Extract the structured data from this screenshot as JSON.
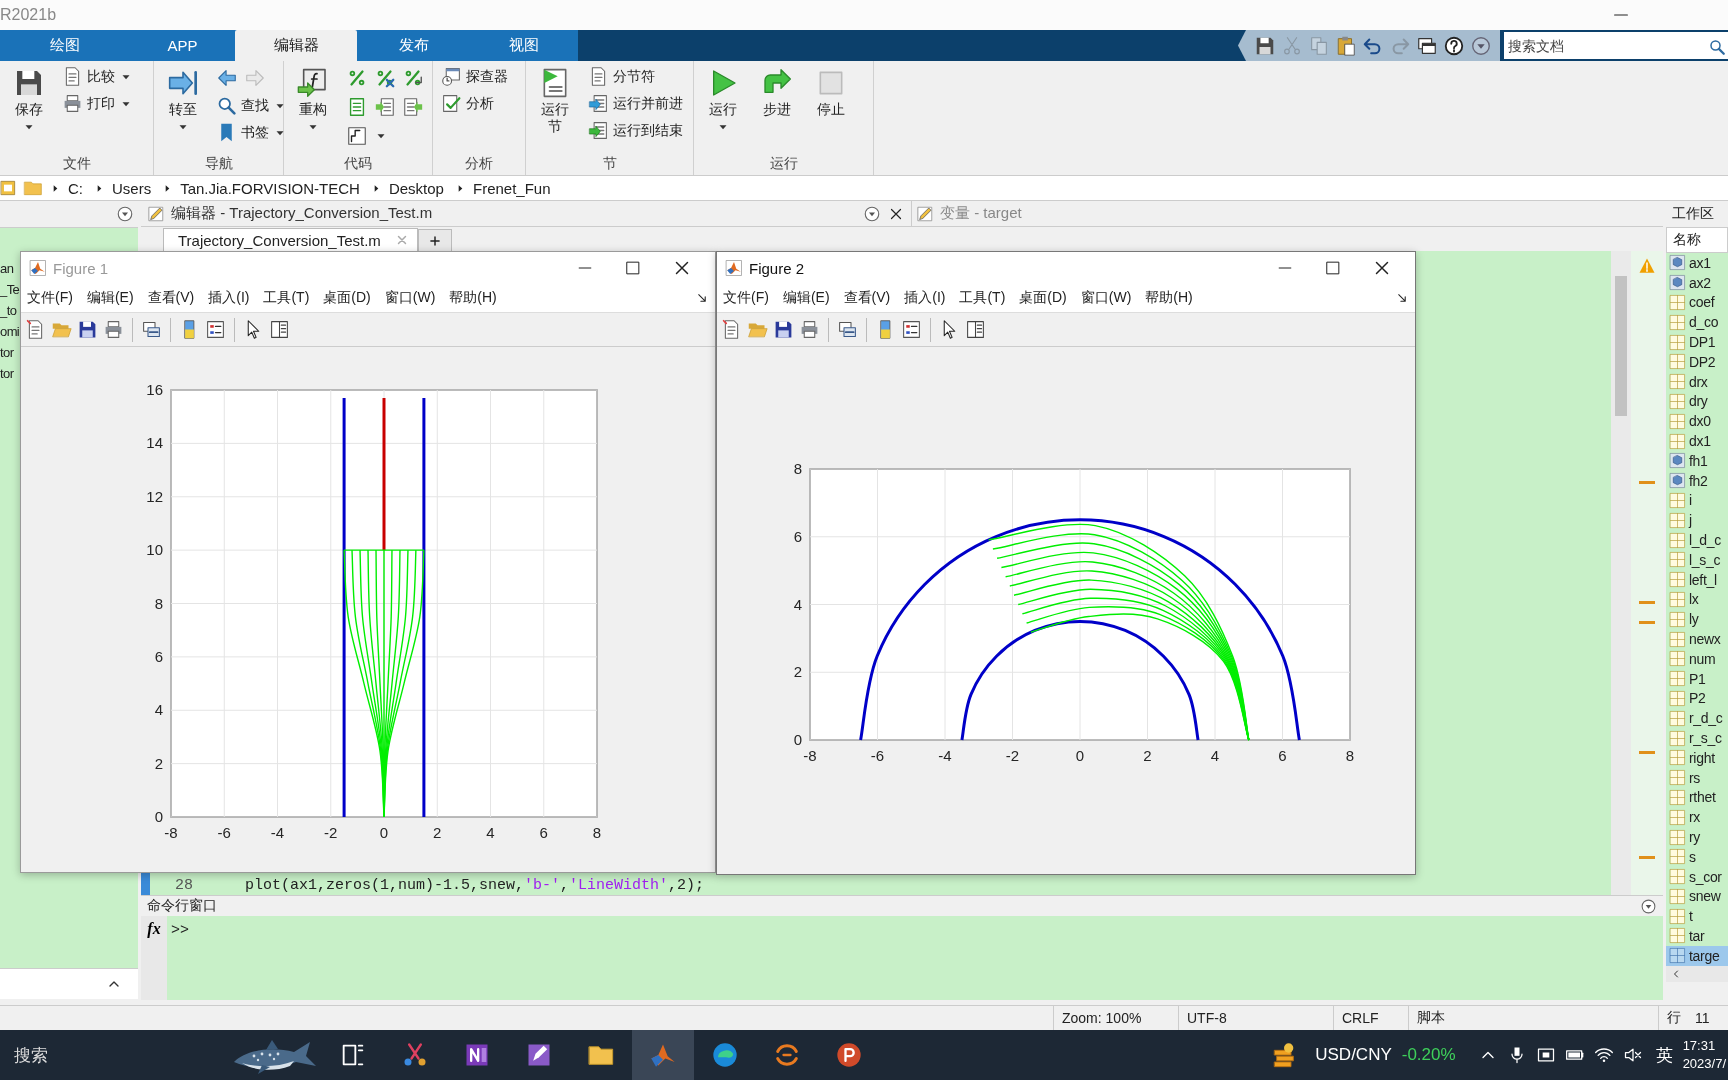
{
  "window": {
    "title": "R2021b"
  },
  "ribbon_tabs": [
    {
      "label": "绘图",
      "selected": false
    },
    {
      "label": "APP",
      "selected": false
    },
    {
      "label": "编辑器",
      "selected": true
    },
    {
      "label": "发布",
      "selected": false
    },
    {
      "label": "视图",
      "selected": false
    }
  ],
  "quick_access": [
    {
      "disabled": false
    },
    {
      "disabled": true
    },
    {
      "disabled": true
    },
    {
      "disabled": false
    },
    {
      "disabled": false
    },
    {
      "disabled": true
    },
    {
      "disabled": false
    },
    {
      "disabled": false
    },
    {
      "disabled": false
    }
  ],
  "search": {
    "placeholder": "搜索文档"
  },
  "ribbon_groups": [
    {
      "title": "文件",
      "columns": [
        [
          {
            "kind": "large",
            "label": "保存",
            "dropdown": true
          }
        ],
        [
          {
            "kind": "small",
            "label": "比较",
            "dropdown": true
          },
          {
            "kind": "small",
            "label": "打印",
            "dropdown": true
          }
        ]
      ]
    },
    {
      "title": "导航",
      "columns": [
        [
          {
            "kind": "large",
            "label": "转至",
            "dropdown": true
          }
        ],
        [
          {
            "kind": "arrows"
          },
          {
            "kind": "small",
            "label": "查找",
            "dropdown": true
          },
          {
            "kind": "small",
            "label": "书签",
            "dropdown": true
          }
        ]
      ]
    },
    {
      "title": "代码",
      "columns": [
        [
          {
            "kind": "large",
            "label": "重构",
            "dropdown": true
          }
        ],
        [
          {
            "kind": "icons"
          },
          {
            "kind": "icons"
          },
          {
            "kind": "icon",
            "dropdown": true
          }
        ]
      ]
    },
    {
      "title": "分析",
      "columns": [
        [
          {
            "kind": "small",
            "label": "探查器",
            "dropdown": false
          },
          {
            "kind": "small",
            "label": "分析",
            "dropdown": false
          }
        ]
      ]
    },
    {
      "title": "节",
      "columns": [
        [
          {
            "kind": "large",
            "label": "运行节",
            "dropdown": false
          }
        ],
        [
          {
            "kind": "small",
            "label": "分节符",
            "dropdown": false
          },
          {
            "kind": "small",
            "label": "运行并前进",
            "dropdown": false
          },
          {
            "kind": "small",
            "label": "运行到结束",
            "dropdown": false
          }
        ]
      ]
    },
    {
      "title": "运行",
      "columns": [
        [
          {
            "kind": "large",
            "label": "运行",
            "dropdown": true,
            "disabled": false
          }
        ],
        [
          {
            "kind": "large",
            "label": "步进",
            "dropdown": false,
            "disabled": false
          }
        ],
        [
          {
            "kind": "large",
            "label": "停止",
            "dropdown": false,
            "disabled": true
          }
        ]
      ]
    }
  ],
  "address_bar": {
    "path": [
      "C:",
      "Users",
      "Tan.Jia.FORVISION-TECH",
      "Desktop",
      "Frenet_Fun"
    ]
  },
  "file_panel": {
    "items": [
      "an",
      "_Te",
      "_to",
      "omi",
      "tor",
      "tor"
    ]
  },
  "editor": {
    "title": "编辑器 - Trajectory_Conversion_Test.m",
    "tabs": [
      {
        "label": "Trajectory_Conversion_Test.m",
        "selected": true
      }
    ],
    "lines": [
      {
        "number": "28",
        "tokens": [
          {
            "kind": "code",
            "text": "plot(ax1,zeros(1,num)-1.5,snew,"
          },
          {
            "kind": "string",
            "text": "'b-'"
          },
          {
            "kind": "code",
            "text": ","
          },
          {
            "kind": "string",
            "text": "'LineWidth'"
          },
          {
            "kind": "code",
            "text": ",2);"
          }
        ]
      }
    ]
  },
  "variable_editor": {
    "title": "变量 - target"
  },
  "command_window": {
    "title": "命令行窗口",
    "function_button": "fx",
    "prompt": ">>"
  },
  "workspace": {
    "title": "工作区",
    "column": "名称",
    "variables": [
      {
        "name": "ax1",
        "kind": "object",
        "selected": false
      },
      {
        "name": "ax2",
        "kind": "object",
        "selected": false
      },
      {
        "name": "coef",
        "kind": "array",
        "selected": false
      },
      {
        "name": "d_co",
        "kind": "array",
        "selected": false
      },
      {
        "name": "DP1",
        "kind": "array",
        "selected": false
      },
      {
        "name": "DP2",
        "kind": "array",
        "selected": false
      },
      {
        "name": "drx",
        "kind": "array",
        "selected": false
      },
      {
        "name": "dry",
        "kind": "array",
        "selected": false
      },
      {
        "name": "dx0",
        "kind": "array",
        "selected": false
      },
      {
        "name": "dx1",
        "kind": "array",
        "selected": false
      },
      {
        "name": "fh1",
        "kind": "object",
        "selected": false
      },
      {
        "name": "fh2",
        "kind": "object",
        "selected": false
      },
      {
        "name": "i",
        "kind": "array",
        "selected": false
      },
      {
        "name": "j",
        "kind": "array",
        "selected": false
      },
      {
        "name": "l_d_c",
        "kind": "array",
        "selected": false
      },
      {
        "name": "l_s_c",
        "kind": "array",
        "selected": false
      },
      {
        "name": "left_l",
        "kind": "array",
        "selected": false
      },
      {
        "name": "lx",
        "kind": "array",
        "selected": false
      },
      {
        "name": "ly",
        "kind": "array",
        "selected": false
      },
      {
        "name": "newx",
        "kind": "array",
        "selected": false
      },
      {
        "name": "num",
        "kind": "array",
        "selected": false
      },
      {
        "name": "P1",
        "kind": "array",
        "selected": false
      },
      {
        "name": "P2",
        "kind": "array",
        "selected": false
      },
      {
        "name": "r_d_c",
        "kind": "array",
        "selected": false
      },
      {
        "name": "r_s_c",
        "kind": "array",
        "selected": false
      },
      {
        "name": "right",
        "kind": "array",
        "selected": false
      },
      {
        "name": "rs",
        "kind": "array",
        "selected": false
      },
      {
        "name": "rthet",
        "kind": "array",
        "selected": false
      },
      {
        "name": "rx",
        "kind": "array",
        "selected": false
      },
      {
        "name": "ry",
        "kind": "array",
        "selected": false
      },
      {
        "name": "s",
        "kind": "array",
        "selected": false
      },
      {
        "name": "s_cor",
        "kind": "array",
        "selected": false
      },
      {
        "name": "snew",
        "kind": "array",
        "selected": false
      },
      {
        "name": "t",
        "kind": "array",
        "selected": false
      },
      {
        "name": "tar",
        "kind": "array",
        "selected": false
      },
      {
        "name": "targe",
        "kind": "array",
        "selected": true
      }
    ]
  },
  "figures": [
    {
      "title": "Figure 1",
      "active": false,
      "menus": [
        "文件(F)",
        "编辑(E)",
        "查看(V)",
        "插入(I)",
        "工具(T)",
        "桌面(D)",
        "窗口(W)",
        "帮助(H)"
      ],
      "chart_data": {
        "type": "line",
        "grid": true,
        "xlim": [
          -8,
          8
        ],
        "ylim": [
          0,
          16
        ],
        "xticks": [
          -8,
          -6,
          -4,
          -2,
          0,
          2,
          4,
          6,
          8
        ],
        "yticks": [
          0,
          2,
          4,
          6,
          8,
          10,
          12,
          14,
          16
        ],
        "series": [
          {
            "color": "#0000c8",
            "x": [
              -1.5,
              -1.5
            ],
            "values": [
              0,
              15.7
            ]
          },
          {
            "color": "#0000c8",
            "x": [
              1.5,
              1.5
            ],
            "values": [
              0,
              15.7
            ]
          },
          {
            "color": "#c80000",
            "x": [
              0,
              0
            ],
            "values": [
              10,
              15.7
            ]
          },
          {
            "color": "#00ee00",
            "x": [
              -1.5,
              1.5
            ],
            "values": [
              10,
              10
            ]
          },
          {
            "color": "#00ee00",
            "x": [
              0,
              -0.155,
              -0.75,
              -1.345,
              -1.5
            ],
            "values": [
              0,
              2.5,
              5,
              7.5,
              10
            ]
          },
          {
            "color": "#00ee00",
            "x": [
              0,
              -0.124,
              -0.6,
              -1.076,
              -1.2
            ],
            "values": [
              0,
              2.5,
              5,
              7.5,
              10
            ]
          },
          {
            "color": "#00ee00",
            "x": [
              0,
              -0.093,
              -0.45,
              -0.807,
              -0.9
            ],
            "values": [
              0,
              2.5,
              5,
              7.5,
              10
            ]
          },
          {
            "color": "#00ee00",
            "x": [
              0,
              -0.062,
              -0.3,
              -0.538,
              -0.6
            ],
            "values": [
              0,
              2.5,
              5,
              7.5,
              10
            ]
          },
          {
            "color": "#00ee00",
            "x": [
              0,
              -0.031,
              -0.15,
              -0.269,
              -0.3
            ],
            "values": [
              0,
              2.5,
              5,
              7.5,
              10
            ]
          },
          {
            "color": "#00ee00",
            "x": [
              0,
              0,
              0,
              0,
              0
            ],
            "values": [
              0,
              2.5,
              5,
              7.5,
              10
            ]
          },
          {
            "color": "#00ee00",
            "x": [
              0,
              0.031,
              0.15,
              0.269,
              0.3
            ],
            "values": [
              0,
              2.5,
              5,
              7.5,
              10
            ]
          },
          {
            "color": "#00ee00",
            "x": [
              0,
              0.062,
              0.3,
              0.538,
              0.6
            ],
            "values": [
              0,
              2.5,
              5,
              7.5,
              10
            ]
          },
          {
            "color": "#00ee00",
            "x": [
              0,
              0.093,
              0.45,
              0.807,
              0.9
            ],
            "values": [
              0,
              2.5,
              5,
              7.5,
              10
            ]
          },
          {
            "color": "#00ee00",
            "x": [
              0,
              0.124,
              0.6,
              1.076,
              1.2
            ],
            "values": [
              0,
              2.5,
              5,
              7.5,
              10
            ]
          },
          {
            "color": "#00ee00",
            "x": [
              0,
              0.155,
              0.75,
              1.345,
              1.5
            ],
            "values": [
              0,
              2.5,
              5,
              7.5,
              10
            ]
          }
        ]
      }
    },
    {
      "title": "Figure 2",
      "active": true,
      "menus": [
        "文件(F)",
        "编辑(E)",
        "查看(V)",
        "插入(I)",
        "工具(T)",
        "桌面(D)",
        "窗口(W)",
        "帮助(H)"
      ],
      "chart_data": {
        "type": "line",
        "grid": true,
        "xlim": [
          -8,
          8
        ],
        "ylim": [
          0,
          8
        ],
        "xticks": [
          -8,
          -6,
          -4,
          -2,
          0,
          2,
          4,
          6,
          8
        ],
        "yticks": [
          0,
          2,
          4,
          6,
          8
        ],
        "series": [
          {
            "color": "#0000c8",
            "x": [
              6.5,
              6.005,
              4.596,
              2.487,
              0,
              -2.487,
              -4.596,
              -6.005,
              -6.5
            ],
            "values": [
              0,
              2.487,
              4.596,
              6.005,
              6.5,
              6.005,
              4.596,
              2.487,
              0
            ]
          },
          {
            "color": "#0000c8",
            "x": [
              3.5,
              3.234,
              2.475,
              1.339,
              0,
              -1.339,
              -2.475,
              -3.234,
              -3.5
            ],
            "values": [
              0,
              1.339,
              2.475,
              3.234,
              3.5,
              3.234,
              2.475,
              1.339,
              0
            ]
          },
          {
            "color": "#00ee00",
            "x": [
              5,
              4.252,
              2.296,
              0.258,
              -1.456
            ],
            "values": [
              0,
              2.323,
              3.576,
              3.646,
              3.183
            ]
          },
          {
            "color": "#00ee00",
            "x": [
              5,
              4.279,
              2.377,
              0.277,
              -1.581
            ],
            "values": [
              0,
              2.338,
              3.703,
              3.914,
              3.455
            ]
          },
          {
            "color": "#00ee00",
            "x": [
              5,
              4.306,
              2.458,
              0.296,
              -1.706
            ],
            "values": [
              0,
              2.352,
              3.829,
              4.183,
              3.728
            ]
          },
          {
            "color": "#00ee00",
            "x": [
              5,
              4.334,
              2.539,
              0.315,
              -1.831
            ],
            "values": [
              0,
              2.367,
              3.955,
              4.451,
              4.001
            ]
          },
          {
            "color": "#00ee00",
            "x": [
              5,
              4.361,
              2.62,
              0.334,
              -1.956
            ],
            "values": [
              0,
              2.382,
              4.081,
              4.719,
              4.274
            ]
          },
          {
            "color": "#00ee00",
            "x": [
              5,
              4.388,
              2.702,
              0.354,
              -2.081
            ],
            "values": [
              0,
              2.397,
              4.208,
              4.988,
              4.547
            ]
          },
          {
            "color": "#00ee00",
            "x": [
              5,
              4.415,
              2.783,
              0.373,
              -2.205
            ],
            "values": [
              0,
              2.412,
              4.334,
              5.256,
              4.819
            ]
          },
          {
            "color": "#00ee00",
            "x": [
              5,
              4.442,
              2.864,
              0.392,
              -2.33
            ],
            "values": [
              0,
              2.427,
              4.46,
              5.524,
              5.092
            ]
          },
          {
            "color": "#00ee00",
            "x": [
              5,
              4.47,
              2.945,
              0.411,
              -2.455
            ],
            "values": [
              0,
              2.442,
              4.586,
              5.792,
              5.365
            ]
          },
          {
            "color": "#00ee00",
            "x": [
              5,
              4.497,
              3.026,
              0.43,
              -2.58
            ],
            "values": [
              0,
              2.456,
              4.712,
              6.061,
              5.638
            ]
          },
          {
            "color": "#00ee00",
            "x": [
              5,
              4.524,
              3.107,
              0.449,
              -2.705
            ],
            "values": [
              0,
              2.471,
              4.839,
              6.329,
              5.91
            ]
          }
        ]
      }
    }
  ],
  "status_bar": {
    "zoom": "Zoom: 100%",
    "encoding": "UTF-8",
    "line_ending": "CRLF",
    "file_type": "脚本",
    "line_label": "行",
    "line_number": "11"
  },
  "taskbar": {
    "search": "搜索",
    "apps": [
      {
        "selected": false
      },
      {
        "selected": false
      },
      {
        "selected": false
      },
      {
        "selected": false
      },
      {
        "selected": false
      },
      {
        "selected": true
      },
      {
        "selected": false
      },
      {
        "selected": false
      },
      {
        "selected": false
      }
    ],
    "ticker": "USD/CNY",
    "change": "-0.20%",
    "ime": "英",
    "time": "17:31",
    "date": "2023/7/"
  }
}
